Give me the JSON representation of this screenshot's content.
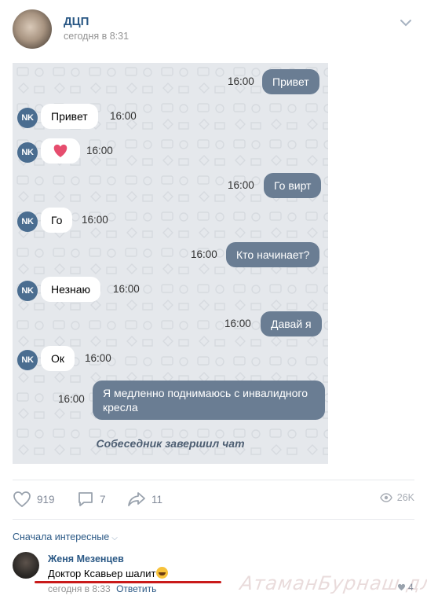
{
  "post": {
    "author": "ДЦП",
    "time": "сегодня в 8:31"
  },
  "chat": {
    "avatar_label": "NK",
    "messages": [
      {
        "dir": "out",
        "text": "Привет",
        "time": "16:00"
      },
      {
        "dir": "in",
        "text": "Привет",
        "time": "16:00"
      },
      {
        "dir": "in",
        "text": "",
        "time": "16:00",
        "emoji": "heart-icon"
      },
      {
        "dir": "out",
        "text": "Го вирт",
        "time": "16:00"
      },
      {
        "dir": "in",
        "text": "Го",
        "time": "16:00"
      },
      {
        "dir": "out",
        "text": "Кто начинает?",
        "time": "16:00"
      },
      {
        "dir": "in",
        "text": "Незнаю",
        "time": "16:00"
      },
      {
        "dir": "out",
        "text": "Давай я",
        "time": "16:00"
      },
      {
        "dir": "in",
        "text": "Ок",
        "time": "16:00"
      },
      {
        "dir": "out",
        "text": "Я медленно поднимаюсь с инвалидного кресла",
        "time": "16:00"
      }
    ],
    "end_text": "Собеседник завершил чат"
  },
  "actions": {
    "likes": "919",
    "comments": "7",
    "shares": "11",
    "views": "26K"
  },
  "comments": {
    "sort_label": "Сначала интересные",
    "items": [
      {
        "author": "Женя Мезенцев",
        "text": "Доктор Ксавьер шалит",
        "time": "сегодня в 8:33",
        "reply_label": "Ответить",
        "likes": "4"
      }
    ]
  },
  "watermark": "АтаманБурнаш для ЯП",
  "colors": {
    "link": "#2a5885",
    "bubble_out": "#6a7d93",
    "avatar_nk": "#4a6d90",
    "chat_bg": "#e5e8ec",
    "heart": "#e64d6e",
    "underline": "#c91a1a"
  }
}
